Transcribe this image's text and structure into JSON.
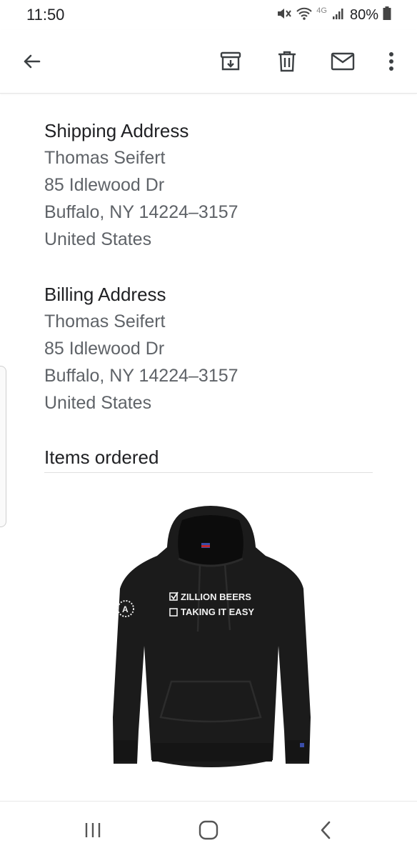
{
  "status": {
    "time": "11:50",
    "network": "4G",
    "battery": "80%"
  },
  "appbar": {
    "icons": [
      "back-arrow-icon",
      "archive-icon",
      "trash-icon",
      "mail-icon",
      "more-vert-icon"
    ]
  },
  "shipping": {
    "title": "Shipping Address",
    "lines": [
      "Thomas Seifert",
      "85 Idlewood Dr",
      "Buffalo, NY 14224–3157",
      "United States"
    ]
  },
  "billing": {
    "title": "Billing Address",
    "lines": [
      "Thomas Seifert",
      "85 Idlewood Dr",
      "Buffalo, NY 14224–3157",
      "United States"
    ]
  },
  "items": {
    "title": "Items ordered",
    "product_print": [
      "ZILLION BEERS",
      "TAKING IT EASY"
    ]
  },
  "navbar": {
    "icons": [
      "recents-icon",
      "home-icon",
      "back-icon"
    ]
  }
}
